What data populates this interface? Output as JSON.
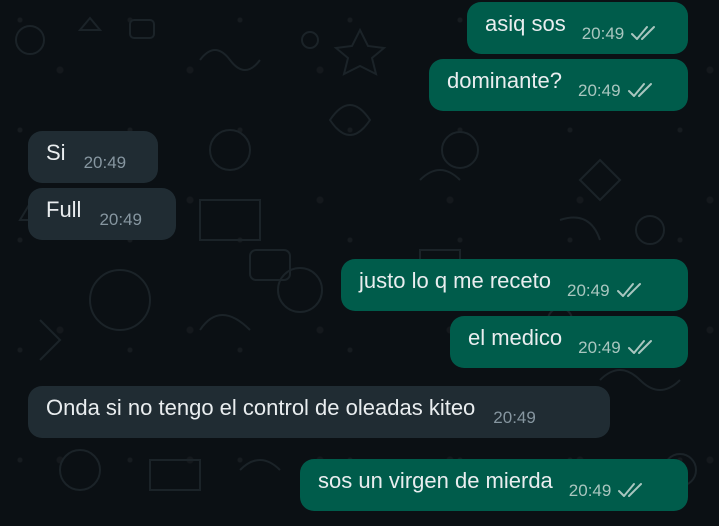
{
  "messages": [
    {
      "text": "asiq sos",
      "time": "20:49",
      "direction": "outgoing",
      "status_icon": "double-check-icon"
    },
    {
      "text": "dominante?",
      "time": "20:49",
      "direction": "outgoing",
      "status_icon": "double-check-icon"
    },
    {
      "text": "Si",
      "time": "20:49",
      "direction": "incoming"
    },
    {
      "text": "Full",
      "time": "20:49",
      "direction": "incoming"
    },
    {
      "text": "justo lo q me receto",
      "time": "20:49",
      "direction": "outgoing",
      "status_icon": "double-check-icon"
    },
    {
      "text": "el medico",
      "time": "20:49",
      "direction": "outgoing",
      "status_icon": "double-check-icon"
    },
    {
      "text": "Onda si no tengo el control de oleadas kiteo",
      "time": "20:49",
      "direction": "incoming"
    },
    {
      "text": "sos un virgen de mierda",
      "time": "20:49",
      "direction": "outgoing",
      "status_icon": "double-check-icon"
    }
  ],
  "colors": {
    "background": "#0b1014",
    "outgoing_bubble": "#005c4b",
    "incoming_bubble": "#202c33",
    "text": "#e9edef",
    "time_outgoing": "#a9c6bf",
    "time_incoming": "#8696a0"
  }
}
